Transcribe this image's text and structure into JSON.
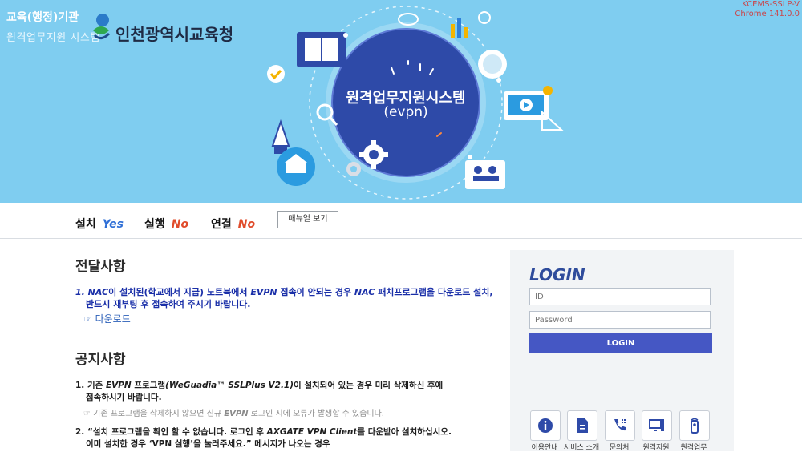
{
  "header": {
    "institution_type": "교육(행정)기관",
    "system_name": "원격업무지원 시스템",
    "org_name": "인천광역시교육청",
    "version_line1": "KCEMS-SSLP-V",
    "version_line2": "Chrome 141.0.0",
    "hero_title": "원격업무지원시스템",
    "hero_subtitle": "(evpn)"
  },
  "status": {
    "install_label": "설치",
    "install_value": "Yes",
    "run_label": "실행",
    "run_value": "No",
    "connect_label": "연결",
    "connect_value": "No",
    "manual_button": "매뉴얼 보기"
  },
  "notices": {
    "delivery_title": "전달사항",
    "delivery_item_pre": "1. ",
    "delivery_item_nac": "NAC",
    "delivery_item_mid": "이 설치된(학교에서 지급) 노트북에서 ",
    "delivery_item_evpn": "EVPN",
    "delivery_item_mid2": " 접속이 안되는 경우 ",
    "delivery_item_nac2": "NAC",
    "delivery_item_end": " 패치프로그램을 다운로드 설치,",
    "delivery_item_line2": "반드시 재부팅 후 접속하여 주시기 바랍니다.",
    "download_link": "☞ 다운로드",
    "notice_title": "공지사항",
    "notice1_pre": "1. 기존 ",
    "notice1_evpn": "EVPN",
    "notice1_mid": " 프로그램",
    "notice1_prod": "(WeGuadia™ SSLPlus V2.1)",
    "notice1_end": "이 설치되어 있는 경우 미리 삭제하신 후에",
    "notice1_line2": "접속하시기 바랍니다.",
    "notice1_sub_pre": "☞ 기존 프로그램을 삭제하지 않으면 신규 ",
    "notice1_sub_evpn": "EVPN",
    "notice1_sub_end": " 로그인 시에 오류가 발생할 수 있습니다.",
    "notice2_pre": "2. “설치 프로그램을 확인 할 수 없습니다. 로그인 후 ",
    "notice2_axgate": "AXGATE VPN Client",
    "notice2_end": "를 다운받아 설치하십시오.",
    "notice2_line2": "이미 설치한 경우 ‘VPN 실행’을 눌러주세요.” 메시지가 나오는 경우"
  },
  "login": {
    "title": "LOGIN",
    "id_placeholder": "ID",
    "password_placeholder": "Password",
    "button": "LOGIN"
  },
  "quick_links": [
    {
      "label": "이용안내",
      "icon": "info-icon"
    },
    {
      "label": "서비스 소개",
      "icon": "document-icon"
    },
    {
      "label": "문의처",
      "icon": "phone-icon"
    },
    {
      "label": "원격지원",
      "icon": "monitor-icon"
    },
    {
      "label": "원격업무",
      "icon": "remote-control-icon"
    }
  ],
  "colors": {
    "banner": "#7fcdf0",
    "hero_circle": "#2e4aa8",
    "login_button": "#4557c4",
    "yes": "#2f6fd6",
    "no": "#e04b2a",
    "notice_blue": "#1a2fa8"
  }
}
